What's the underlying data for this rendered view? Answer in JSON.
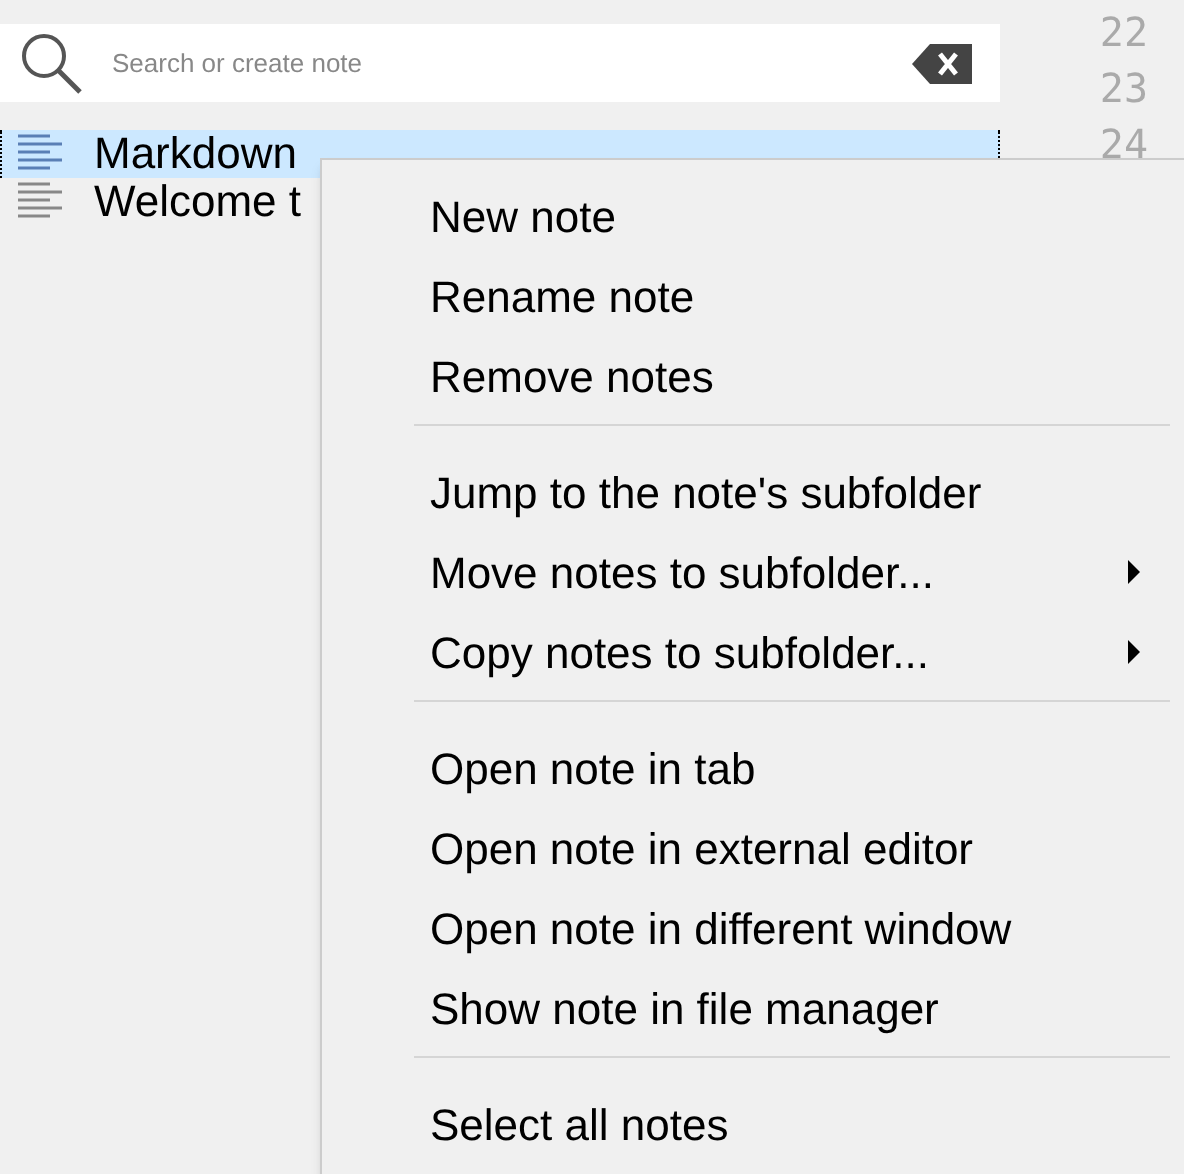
{
  "search": {
    "placeholder": "Search or create note"
  },
  "line_numbers": [
    "22",
    "23",
    "24"
  ],
  "notes": [
    {
      "title": "Markdown",
      "selected": true
    },
    {
      "title": "Welcome t",
      "selected": false
    }
  ],
  "context_menu": {
    "groups": [
      [
        {
          "label": "New note",
          "submenu": false
        },
        {
          "label": "Rename note",
          "submenu": false
        },
        {
          "label": "Remove notes",
          "submenu": false
        }
      ],
      [
        {
          "label": "Jump to the note's subfolder",
          "submenu": false
        },
        {
          "label": "Move notes to subfolder...",
          "submenu": true
        },
        {
          "label": "Copy notes to subfolder...",
          "submenu": true
        }
      ],
      [
        {
          "label": "Open note in tab",
          "submenu": false
        },
        {
          "label": "Open note in external editor",
          "submenu": false
        },
        {
          "label": "Open note in different window",
          "submenu": false
        },
        {
          "label": "Show note in file manager",
          "submenu": false
        }
      ],
      [
        {
          "label": "Select all notes",
          "submenu": false
        }
      ]
    ]
  }
}
